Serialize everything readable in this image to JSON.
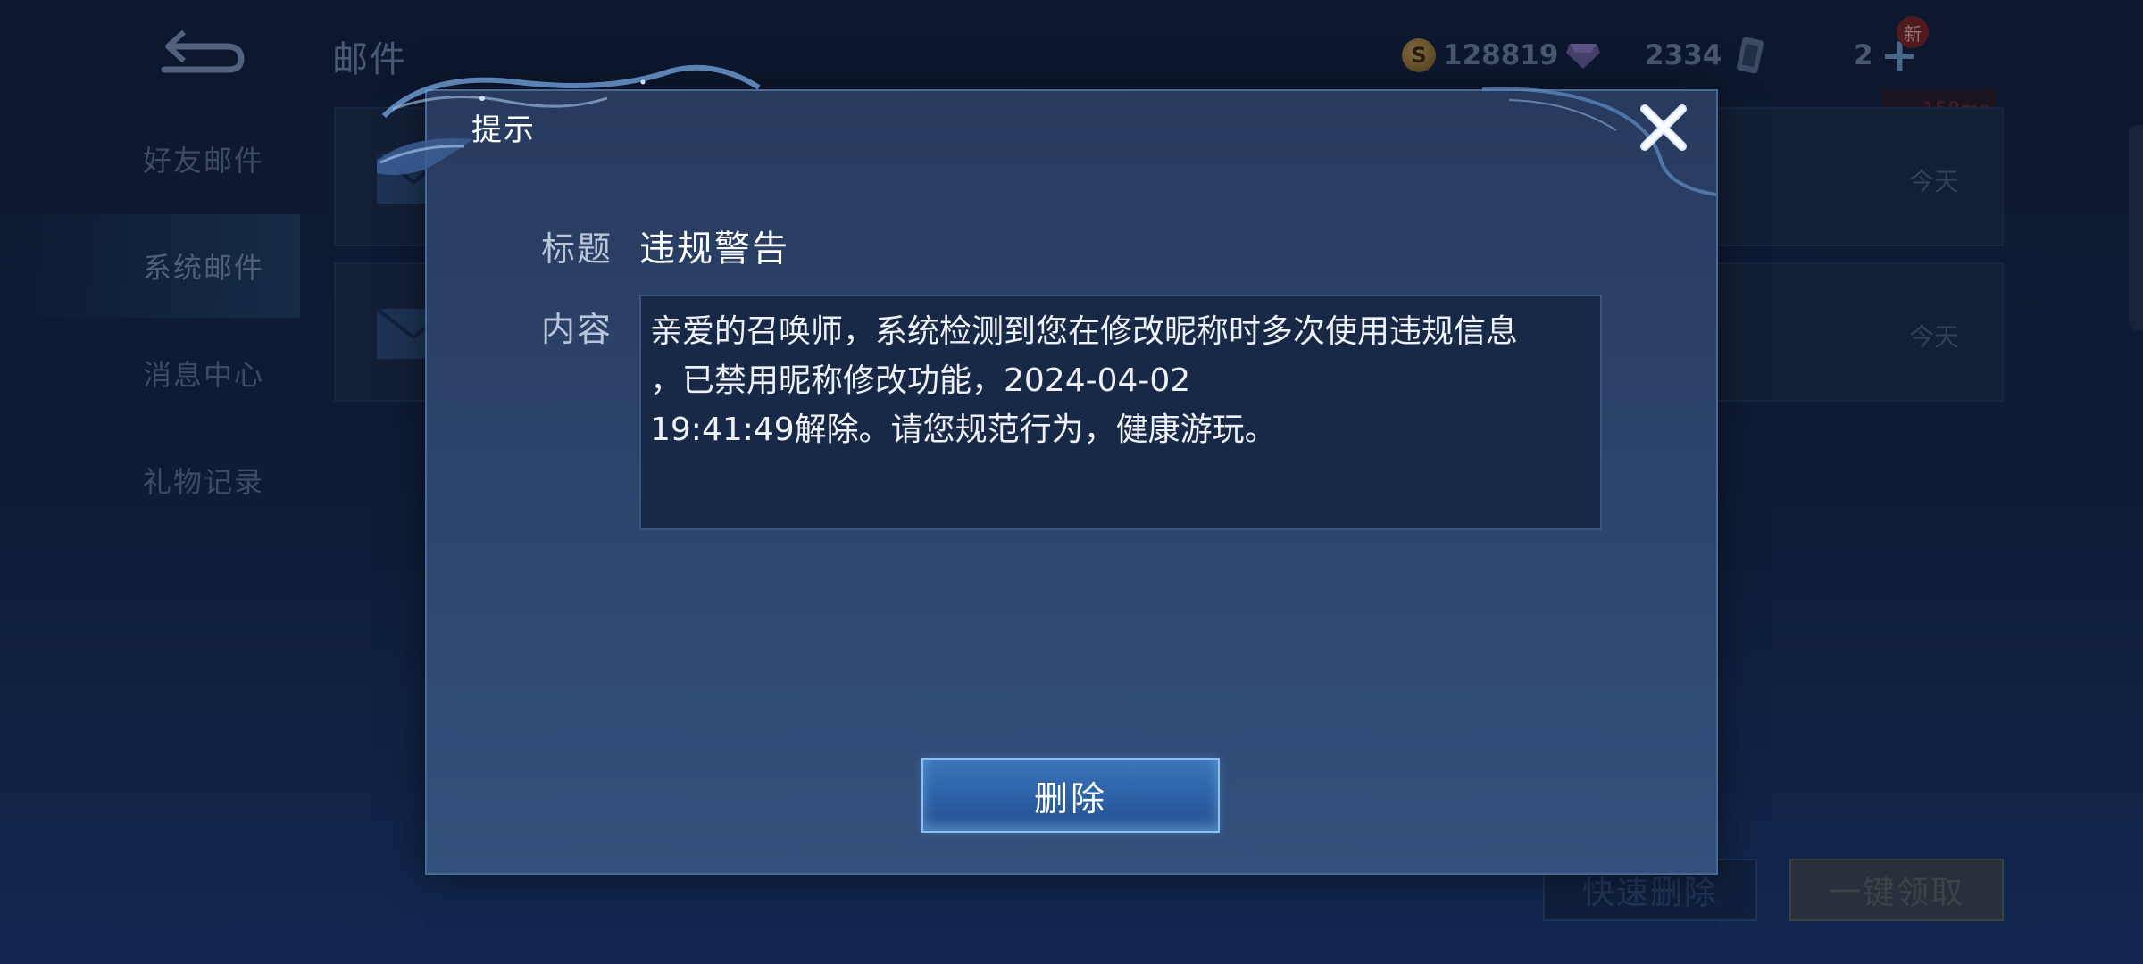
{
  "header": {
    "title": "邮件",
    "gold": "128819",
    "gems": "2334",
    "tickets": "2",
    "new_badge": "新",
    "ping": "158ms"
  },
  "sidebar": {
    "items": [
      {
        "label": "好友邮件"
      },
      {
        "label": "系统邮件"
      },
      {
        "label": "消息中心"
      },
      {
        "label": "礼物记录"
      }
    ]
  },
  "mail_list": {
    "rows": [
      {
        "date": "今天"
      },
      {
        "date": "今天"
      }
    ]
  },
  "actions": {
    "quick_delete": "快速删除",
    "claim_all": "一键领取"
  },
  "dialog": {
    "title": "提示",
    "subject_label": "标题",
    "subject": "违规警告",
    "content_label": "内容",
    "content_lines": [
      "亲爱的召唤师，系统检测到您在修改昵称时多次使用违规信息",
      "，已禁用昵称修改功能，2024-04-02",
      "19:41:49解除。请您规范行为，健康游玩。"
    ],
    "delete_label": "删除"
  },
  "colors": {
    "accent": "#3b75b8",
    "dialog_bg": "#2e4770",
    "content_bg": "#182847"
  }
}
